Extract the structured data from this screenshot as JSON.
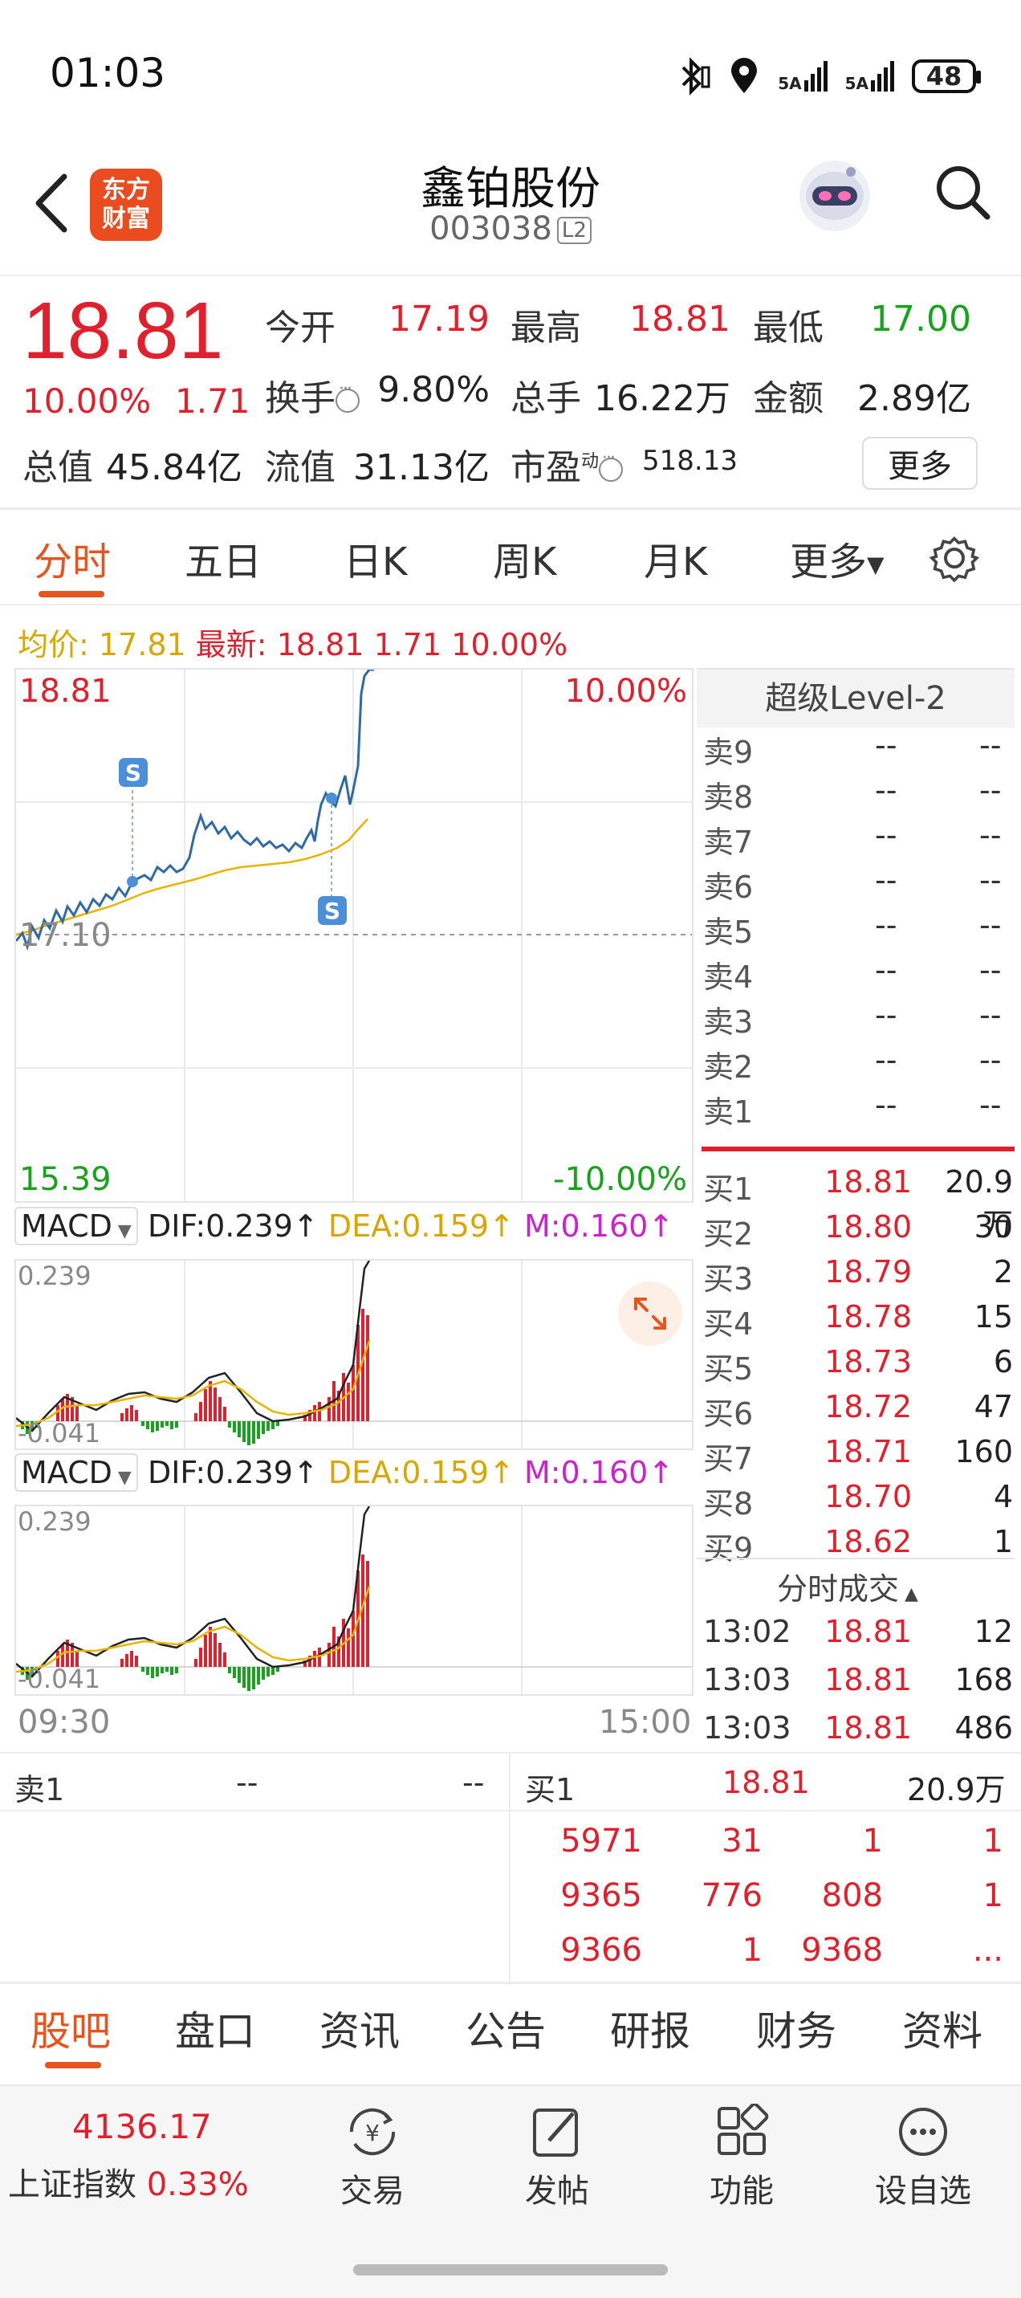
{
  "status_bar": {
    "time": "01:03",
    "battery": "48",
    "signal1": "5A",
    "signal2": "5A"
  },
  "header": {
    "logo_line1": "东方",
    "logo_line2": "财富",
    "stock_name": "鑫铂股份",
    "stock_code": "003038",
    "level_badge": "L2"
  },
  "quote": {
    "price": "18.81",
    "change_pct": "10.00%",
    "change_amt": "1.71",
    "open_label": "今开",
    "open": "17.19",
    "high_label": "最高",
    "high": "18.81",
    "low_label": "最低",
    "low": "17.00",
    "turnover_label": "换手",
    "turnover": "9.80%",
    "volume_label": "总手",
    "volume": "16.22万",
    "amount_label": "金额",
    "amount": "2.89亿",
    "mktcap_label": "总值",
    "mktcap": "45.84亿",
    "float_label": "流值",
    "float_cap": "31.13亿",
    "pe_label": "市盈",
    "pe_sup": "动",
    "pe": "518.13",
    "more_button": "更多"
  },
  "chart_tabs": [
    "分时",
    "五日",
    "日K",
    "周K",
    "月K",
    "更多"
  ],
  "intraday": {
    "avg_label": "均价:",
    "avg": "17.81",
    "latest_label": "最新:",
    "latest": "18.81",
    "latest_chg": "1.71",
    "latest_pct": "10.00%",
    "y_top": "18.81",
    "y_top_pct": "10.00%",
    "y_mid": "17.10",
    "y_bottom": "15.39",
    "y_bottom_pct": "-10.00%",
    "x_start": "09:30",
    "x_end": "15:00",
    "marker": "S",
    "colors": {
      "price_line": "#2d6aa6",
      "avg_line": "#e8b400",
      "up": "#e0212d",
      "down": "#19a21d"
    }
  },
  "macd_panels": [
    {
      "name": "MACD",
      "dif": "DIF:0.239",
      "dea": "DEA:0.159",
      "m": "M:0.160",
      "top": "0.239",
      "bottom": "-0.041"
    },
    {
      "name": "MACD",
      "dif": "DIF:0.239",
      "dea": "DEA:0.159",
      "m": "M:0.160",
      "top": "0.239",
      "bottom": "-0.041"
    }
  ],
  "level2": {
    "title": "超级Level-2",
    "asks": [
      {
        "label": "卖9",
        "price": "--",
        "vol": "--"
      },
      {
        "label": "卖8",
        "price": "--",
        "vol": "--"
      },
      {
        "label": "卖7",
        "price": "--",
        "vol": "--"
      },
      {
        "label": "卖6",
        "price": "--",
        "vol": "--"
      },
      {
        "label": "卖5",
        "price": "--",
        "vol": "--"
      },
      {
        "label": "卖4",
        "price": "--",
        "vol": "--"
      },
      {
        "label": "卖3",
        "price": "--",
        "vol": "--"
      },
      {
        "label": "卖2",
        "price": "--",
        "vol": "--"
      },
      {
        "label": "卖1",
        "price": "--",
        "vol": "--"
      }
    ],
    "bids": [
      {
        "label": "买1",
        "price": "18.81",
        "vol": "20.9万"
      },
      {
        "label": "买2",
        "price": "18.80",
        "vol": "30"
      },
      {
        "label": "买3",
        "price": "18.79",
        "vol": "2"
      },
      {
        "label": "买4",
        "price": "18.78",
        "vol": "15"
      },
      {
        "label": "买5",
        "price": "18.73",
        "vol": "6"
      },
      {
        "label": "买6",
        "price": "18.72",
        "vol": "47"
      },
      {
        "label": "买7",
        "price": "18.71",
        "vol": "160"
      },
      {
        "label": "买8",
        "price": "18.70",
        "vol": "4"
      },
      {
        "label": "买9",
        "price": "18.62",
        "vol": "1"
      }
    ],
    "ticks_title": "分时成交",
    "ticks": [
      {
        "time": "13:02",
        "price": "18.81",
        "vol": "12"
      },
      {
        "time": "13:03",
        "price": "18.81",
        "vol": "168"
      },
      {
        "time": "13:03",
        "price": "18.81",
        "vol": "486"
      }
    ]
  },
  "queue": {
    "sell_label": "卖1",
    "sell_price": "--",
    "sell_vol": "--",
    "buy_label": "买1",
    "buy_price": "18.81",
    "buy_vol": "20.9万",
    "rows": [
      [
        "5971",
        "31",
        "1",
        "1"
      ],
      [
        "9365",
        "776",
        "808",
        "1"
      ],
      [
        "9366",
        "1",
        "9368",
        "..."
      ]
    ]
  },
  "bottom_tabs": [
    "股吧",
    "盘口",
    "资讯",
    "公告",
    "研报",
    "财务",
    "资料"
  ],
  "index": {
    "value": "4136.17",
    "name": "上证指数",
    "pct": "0.33%"
  },
  "bottom_nav": [
    "交易",
    "发帖",
    "功能",
    "设自选"
  ]
}
